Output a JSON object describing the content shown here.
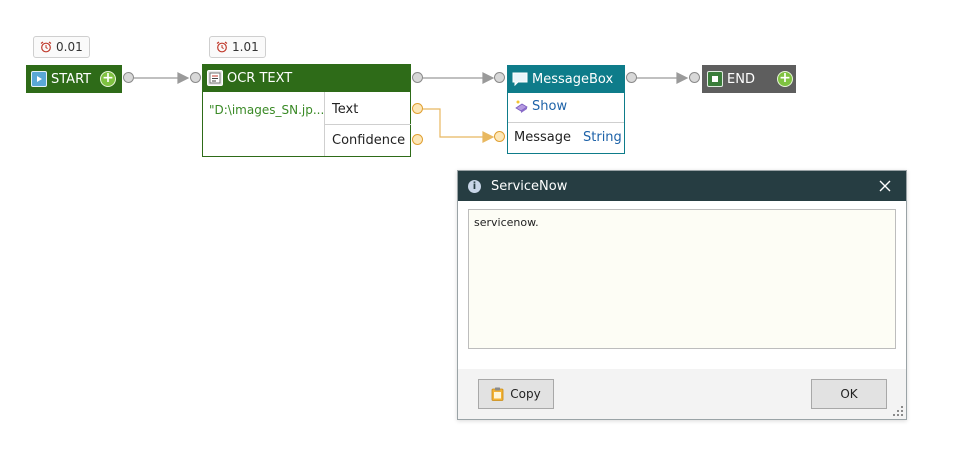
{
  "colors": {
    "start_node": "#2e6b18",
    "ocr_node": "#2e6b18",
    "messagebox_node": "#0e7c8a",
    "end_node": "#5e5e5e",
    "dialog_titlebar": "#263d42",
    "connector": "#9a9a9a",
    "data_link": "#e8b860"
  },
  "timers": {
    "start": "0.01",
    "ocr": "1.01"
  },
  "nodes": {
    "start": {
      "label": "START",
      "icon": "start-icon"
    },
    "ocr": {
      "label": "OCR TEXT",
      "icon": "ocr-icon",
      "input_value": "\"D:\\images_SN.jp...",
      "outputs": [
        "Text",
        "Confidence"
      ]
    },
    "messagebox": {
      "label": "MessageBox",
      "icon": "speech-bubble-icon",
      "action": "Show",
      "param_name": "Message",
      "param_type": "String"
    },
    "end": {
      "label": "END",
      "icon": "end-icon"
    }
  },
  "dialog": {
    "title": "ServiceNow",
    "message": "servicenow.",
    "copy_label": "Copy",
    "ok_label": "OK"
  }
}
